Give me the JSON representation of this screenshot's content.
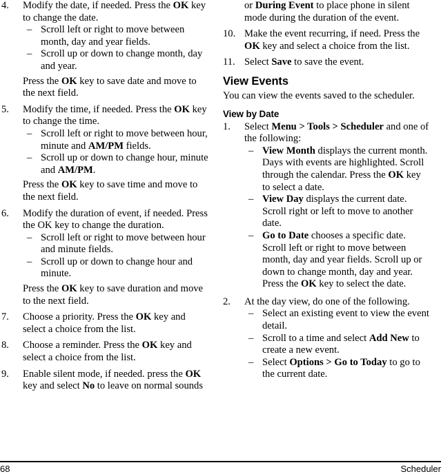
{
  "document": {
    "footer": {
      "page_number": "68",
      "section_title": "Scheduler"
    }
  },
  "left_column": {
    "items": [
      {
        "number": "4.",
        "text_html": "Modify the date, if needed. Press the <b>OK</b> key to change the date.",
        "sub_items": [
          "Scroll left or right to move between month, day and year fields.",
          "Scroll up or down to change month, day and year."
        ],
        "trailing_html": "Press the <b>OK</b> key to save date and move to the next field."
      },
      {
        "number": "5.",
        "text_html": "Modify the time, if needed. Press the <b>OK</b> key to change the time.",
        "sub_items_html": [
          "Scroll left or right to move between hour, minute and <b>AM/PM</b> fields.",
          "Scroll up or down to change hour, minute and <b>AM/PM</b>."
        ],
        "trailing_html": "Press the <b>OK</b> key to save time and move to the next field."
      },
      {
        "number": "6.",
        "text_html": "Modify the duration of event, if needed. Press the OK key to change the duration.",
        "sub_items": [
          "Scroll left or right to move between hour and minute fields.",
          "Scroll up or down to change hour and minute."
        ],
        "trailing_html": "Press the <b>OK</b> key to save duration and move to the next field."
      },
      {
        "number": "7.",
        "text_html": "Choose a priority. Press the <b>OK</b> key and select a choice from the list."
      },
      {
        "number": "8.",
        "text_html": "Choose a reminder. Press the <b>OK</b> key and select a choice from the list."
      },
      {
        "number": "9.",
        "text_html": "Enable silent mode, if needed. press the <b>OK</b> key and select <b>No</b> to leave on normal sounds"
      }
    ]
  },
  "right_column": {
    "carryover_html": "or <b>During Event</b> to place phone in silent mode during the duration of the event.",
    "items_top": [
      {
        "number": "10.",
        "text_html": "Make the event recurring, if need. Press the <b>OK</b> key and select a choice from the list."
      },
      {
        "number": "11.",
        "text_html": "Select <b>Save</b> to save the event."
      }
    ],
    "heading_view_events": "View Events",
    "intro_view_events": "You can view the events saved to the scheduler.",
    "heading_view_by_date": "View by Date",
    "items_bottom": [
      {
        "number": "1.",
        "text_html": "Select <b>Menu &gt; Tools &gt; Scheduler</b> and one of the following:",
        "sub_items_html": [
          "<b>View Month</b> displays the current month. Days with events are highlighted. Scroll through the calendar. Press the <b>OK</b> key to select a date.",
          "<b>View Day</b> displays the current date. Scroll right or left to move to another date.",
          "<b>Go to Date</b> chooses a specific date. Scroll left or right to move between month, day and year fields. Scroll up or down to change month, day and year. Press the <b>OK</b> key to select the date."
        ]
      },
      {
        "number": "2.",
        "text_html": "At the day view, do one of the following.",
        "sub_items_html": [
          "Select an existing event to view the event detail.",
          "Scroll to a time and select <b>Add New</b> to create a new event.",
          "Select <b>Options &gt; Go to Today</b> to go to the current date."
        ]
      }
    ]
  },
  "symbols": {
    "dash": "–"
  }
}
